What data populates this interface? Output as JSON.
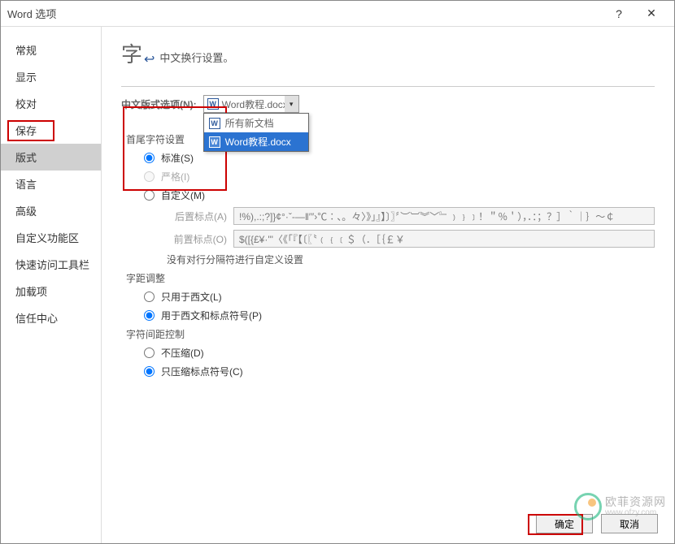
{
  "title": "Word 选项",
  "sidebar": {
    "items": [
      {
        "label": "常规"
      },
      {
        "label": "显示"
      },
      {
        "label": "校对"
      },
      {
        "label": "保存"
      },
      {
        "label": "版式"
      },
      {
        "label": "语言"
      },
      {
        "label": "高级"
      },
      {
        "label": "自定义功能区"
      },
      {
        "label": "快速访问工具栏"
      },
      {
        "label": "加载项"
      },
      {
        "label": "信任中心"
      }
    ],
    "selectedIndex": 4
  },
  "header": {
    "glyph": "字",
    "text": "中文换行设置。"
  },
  "section1": {
    "label": "中文版式选项(N):",
    "selected": "Word教程.docx",
    "options": [
      {
        "label": "所有新文档"
      },
      {
        "label": "Word教程.docx"
      }
    ]
  },
  "group_first": {
    "title": "首尾字符设置",
    "options": [
      {
        "label": "标准(S)",
        "checked": true,
        "disabled": false
      },
      {
        "label": "严格(I)",
        "checked": false,
        "disabled": true
      },
      {
        "label": "自定义(M)",
        "checked": false,
        "disabled": false
      }
    ],
    "post_label": "后置标点(A)",
    "post_value": "!%),.:;?]}¢°·ˇ‐―‖′″›℃∶、。々〉》」』】〕〗〞︶︺︾﹀﹄﹚﹜﹞！＂％＇），．：；？］｀｜｝～￠",
    "pre_label": "前置标点(O)",
    "pre_value": "$([{£¥·'\"〈《「『【〔〖〝﹙﹛﹝＄（．［｛￡￥",
    "note": "没有对行分隔符进行自定义设置"
  },
  "group_kerning": {
    "title": "字距调整",
    "options": [
      {
        "label": "只用于西文(L)",
        "checked": false
      },
      {
        "label": "用于西文和标点符号(P)",
        "checked": true
      }
    ]
  },
  "group_spacing": {
    "title": "字符间距控制",
    "options": [
      {
        "label": "不压缩(D)",
        "checked": false
      },
      {
        "label": "只压缩标点符号(C)",
        "checked": true
      }
    ]
  },
  "footer": {
    "ok": "确定",
    "cancel": "取消"
  },
  "watermark": {
    "cn": "欧菲资源网",
    "en": "www.ofzy.com"
  }
}
